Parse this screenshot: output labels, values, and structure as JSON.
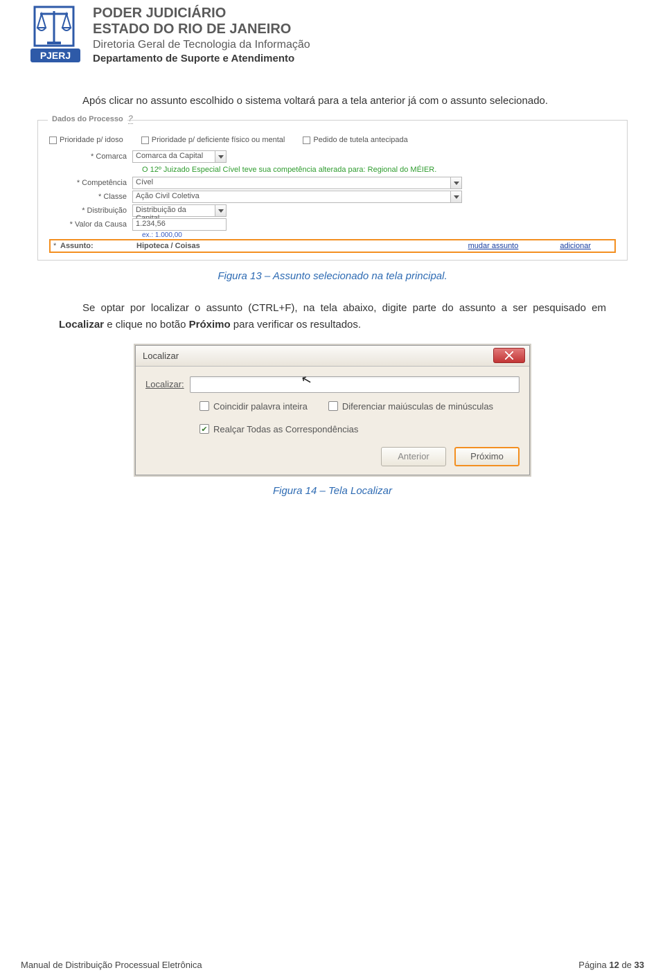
{
  "header": {
    "line1": "PODER JUDICIÁRIO",
    "line2": "ESTADO DO RIO DE JANEIRO",
    "line3": "Diretoria Geral de Tecnologia da Informação",
    "line4": "Departamento de Suporte e Atendimento",
    "logo_label": "PJERJ"
  },
  "paragraph1": "Após clicar no assunto escolhido o sistema voltará para a tela anterior já com o assunto selecionado.",
  "figure13": {
    "legend": "Dados do Processo",
    "checks": {
      "c1": "Prioridade p/ idoso",
      "c2": "Prioridade p/ deficiente físico ou mental",
      "c3": "Pedido de tutela antecipada"
    },
    "comarca": {
      "label": "Comarca",
      "value": "Comarca da Capital"
    },
    "green_msg": "O 12º Juizado Especial Cível teve sua competência alterada para: Regional do MÉIER.",
    "competencia": {
      "label": "Competência",
      "value": "Cível"
    },
    "classe": {
      "label": "Classe",
      "value": "Ação Civil Coletiva"
    },
    "distribuicao": {
      "label": "Distribuição",
      "value": "Distribuição da Capital"
    },
    "valor": {
      "label": "Valor da Causa",
      "value": "1.234,56",
      "ex": "ex.: 1.000,00"
    },
    "assunto": {
      "label": "Assunto:",
      "value": "Hipoteca / Coisas",
      "link_mudar": "mudar assunto",
      "link_add": "adicionar"
    },
    "caption": "Figura 13 – Assunto selecionado na tela principal."
  },
  "paragraph2_a": "Se optar por localizar o assunto (CTRL+F), na tela abaixo, digite parte do assunto a ser pesquisado em ",
  "paragraph2_b": "Localizar",
  "paragraph2_c": " e clique no botão ",
  "paragraph2_d": "Próximo",
  "paragraph2_e": " para verificar os resultados.",
  "figure14": {
    "title": "Localizar",
    "label": "Localizar:",
    "chk_coincidir": "Coincidir palavra inteira",
    "chk_diferenciar": "Diferenciar maiúsculas de minúsculas",
    "chk_realcar": "Realçar Todas as Correspondências",
    "btn_prev": "Anterior",
    "btn_next": "Próximo",
    "caption": "Figura 14 – Tela Localizar"
  },
  "footer": {
    "left": "Manual de Distribuição Processual Eletrônica",
    "right_prefix": "Página ",
    "page_current": "12",
    "right_mid": " de ",
    "page_total": "33"
  }
}
